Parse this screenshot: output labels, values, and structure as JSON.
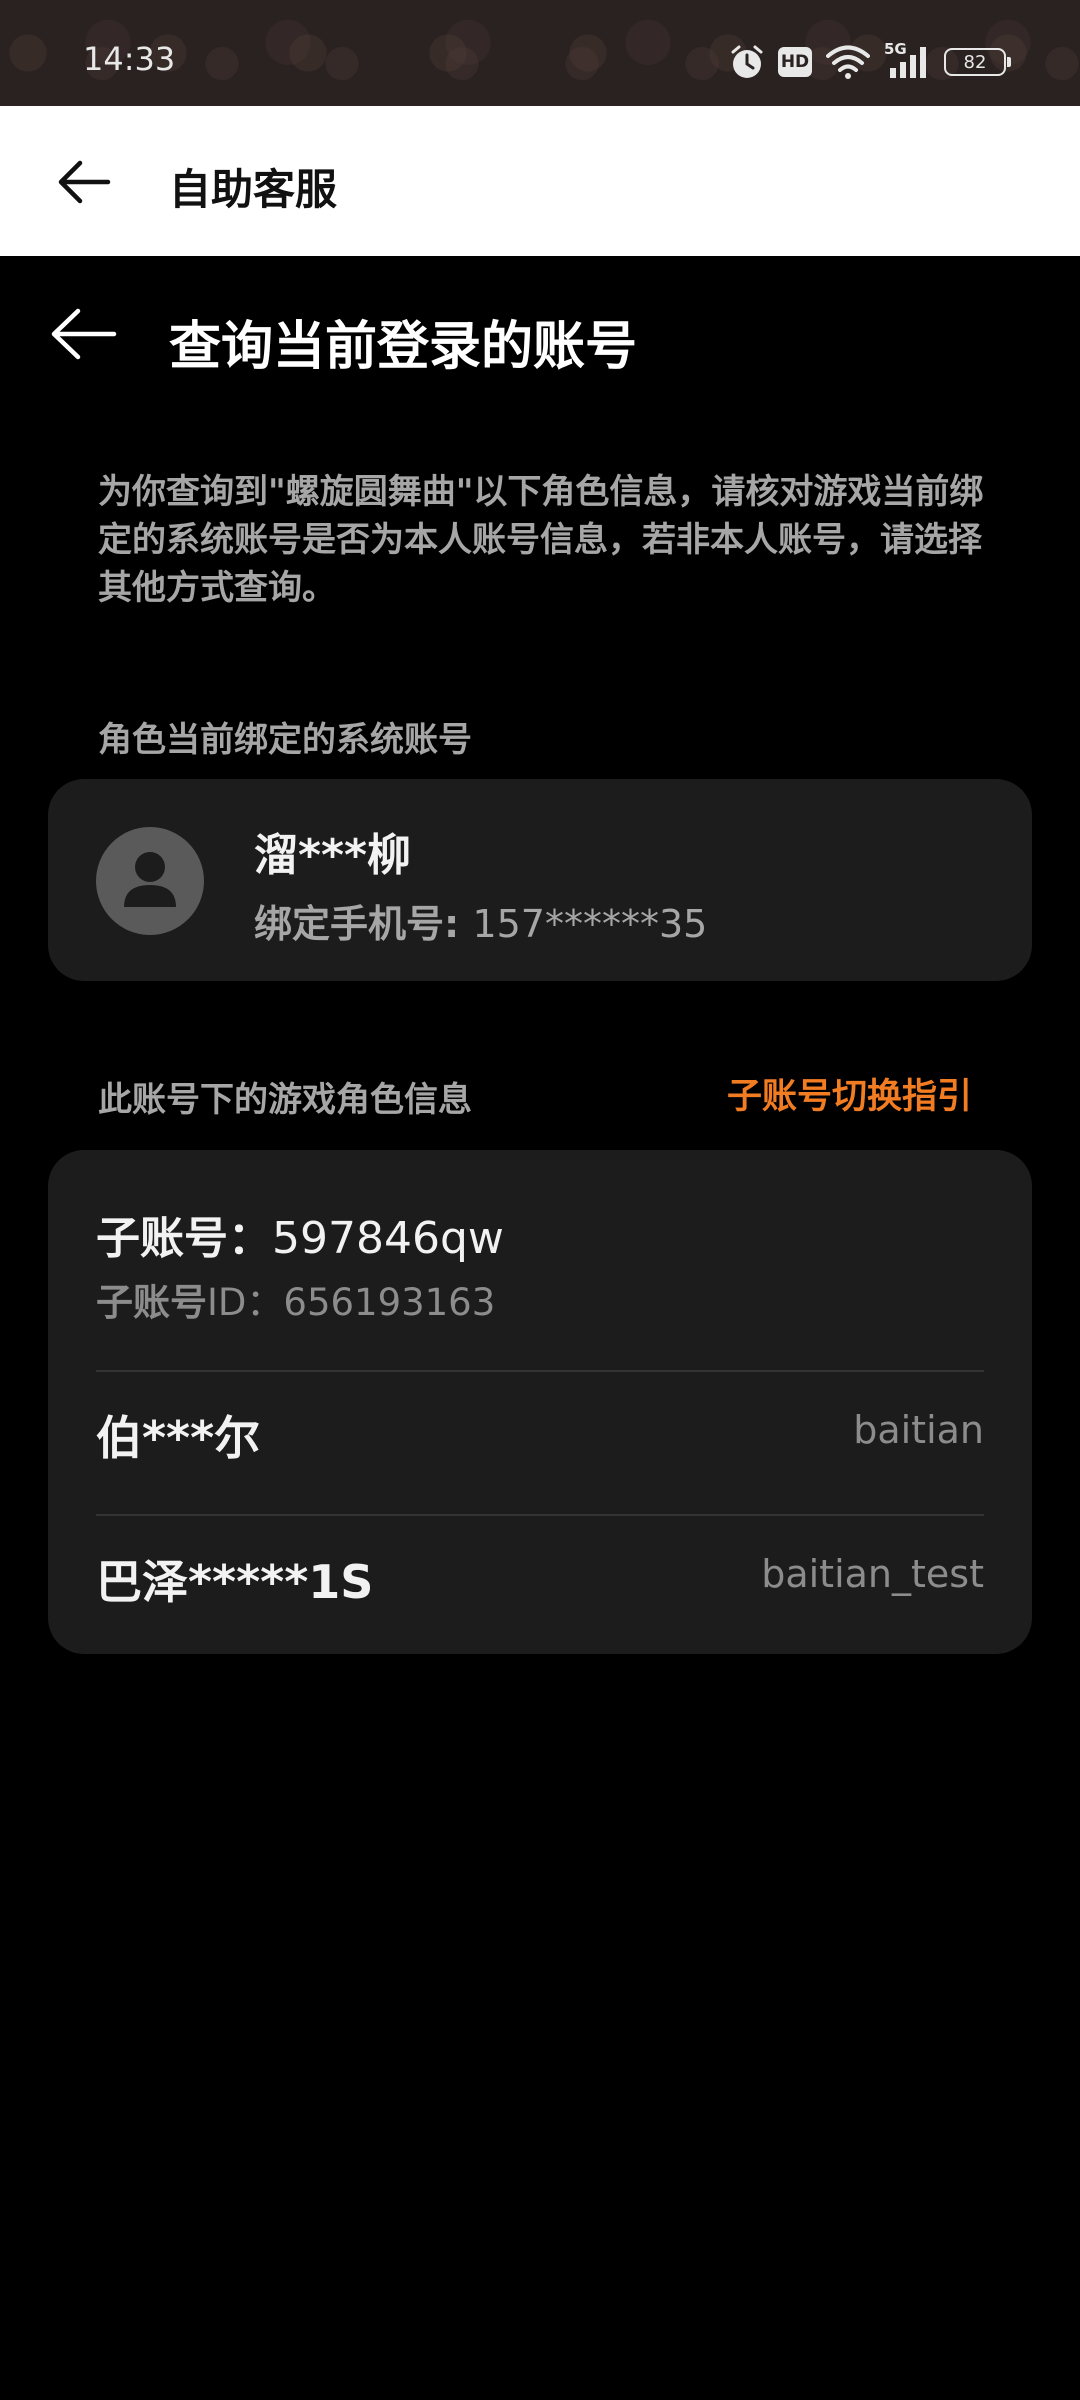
{
  "status_bar": {
    "time": "14:33",
    "icons": [
      "alarm-icon",
      "hd-icon",
      "wifi-icon",
      "signal-5g-icon"
    ],
    "signal_label": "5G",
    "hd_label": "HD",
    "battery": "82"
  },
  "app_bar": {
    "back_icon": "arrow-left-icon",
    "title": "自助客服"
  },
  "page": {
    "back_icon": "arrow-left-icon",
    "title": "查询当前登录的账号",
    "description": "为你查询到\"螺旋圆舞曲\"以下角色信息，请核对游戏当前绑定的系统账号是否为本人账号信息，若非本人账号，请选择其他方式查询。"
  },
  "account_section": {
    "label": "角色当前绑定的系统账号",
    "avatar_icon": "user-avatar-icon",
    "name": "溜***柳",
    "phone_label": "绑定手机号: ",
    "phone": "157******35"
  },
  "roles_section": {
    "label": "此账号下的游戏角色信息",
    "switch_guide": "子账号切换指引",
    "sub_account_label": "子账号：",
    "sub_account": "597846qw",
    "sub_id_label": "子账号",
    "sub_id_value": "ID：656193163",
    "roles": [
      {
        "name": "伯***尔",
        "server": "baitian"
      },
      {
        "name": "巴泽*****1S",
        "server": "baitian_test"
      }
    ]
  },
  "colors": {
    "background": "#000000",
    "card": "#1c1c1c",
    "accent": "#f27c22",
    "muted_text": "#a6a6a6"
  }
}
